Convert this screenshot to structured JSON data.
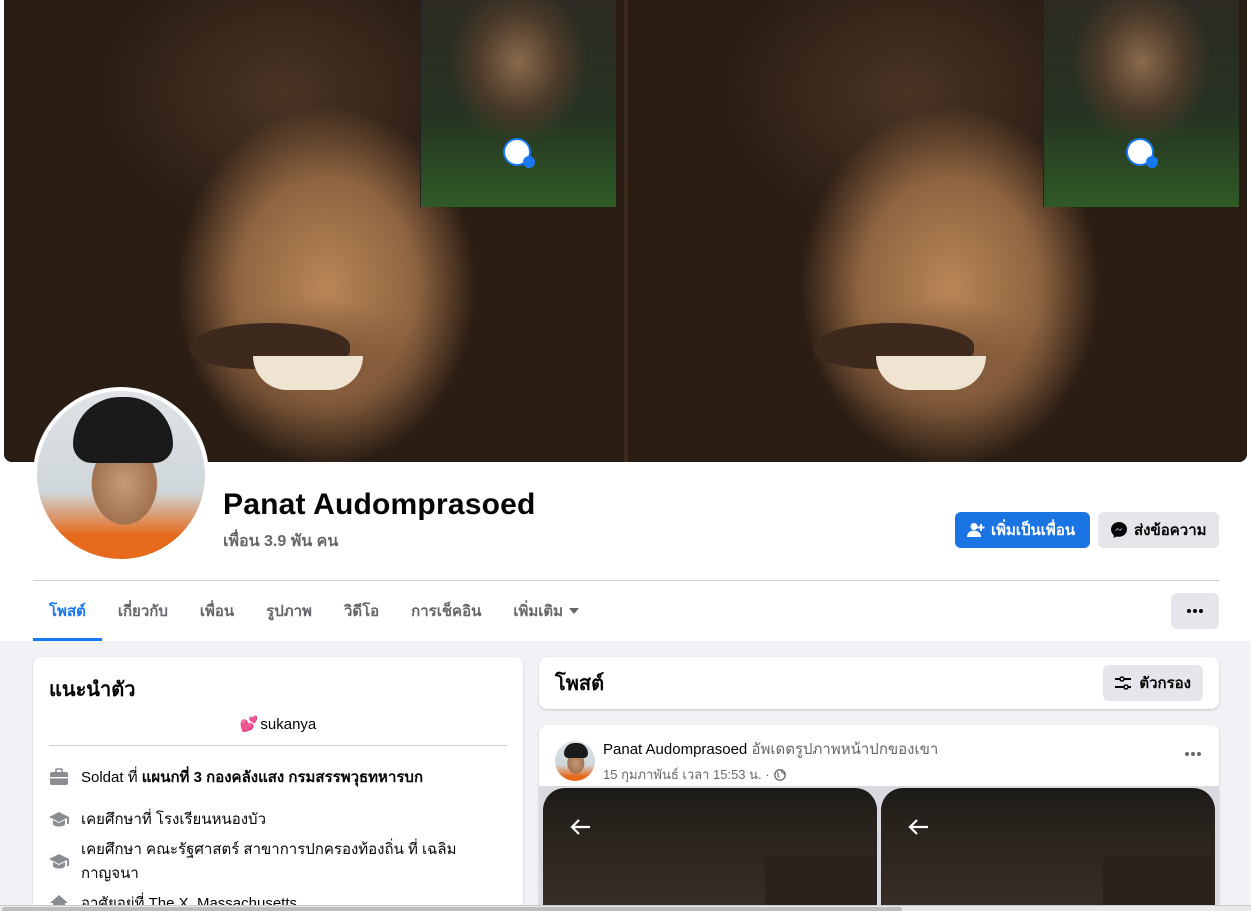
{
  "profile": {
    "name": "Panat Audomprasoed",
    "friends": "เพื่อน 3.9 พัน คน"
  },
  "actions": {
    "add_friend": "เพิ่มเป็นเพื่อน",
    "message": "ส่งข้อความ"
  },
  "tabs": [
    {
      "label": "โพสต์",
      "active": true
    },
    {
      "label": "เกี่ยวกับ",
      "active": false
    },
    {
      "label": "เพื่อน",
      "active": false
    },
    {
      "label": "รูปภาพ",
      "active": false
    },
    {
      "label": "วิดีโอ",
      "active": false
    },
    {
      "label": "การเช็คอิน",
      "active": false
    },
    {
      "label": "เพิ่มเติม",
      "active": false
    }
  ],
  "intro": {
    "title": "แนะนำตัว",
    "bio": "sukanya",
    "work": {
      "prefix": "Soldat ที่ ",
      "place": "แผนกที่ 3 กองคลังแสง กรมสรรพวุธทหารบก"
    },
    "edu1": "เคยศึกษาที่ โรงเรียนหนองบัว",
    "edu2": "เคยศึกษา คณะรัฐศาสตร์ สาขาการปกครองท้องถิ่น ที่ เฉลิมกาญจนา",
    "lives": "อาศัยอยู่ที่ The X, Massachusetts"
  },
  "posts": {
    "title": "โพสต์",
    "filter": "ตัวกรอง",
    "item": {
      "author": "Panat Audomprasoed",
      "action": "อัพเดตรูปภาพหน้าปกของเขา",
      "time": "15 กุมภาพันธ์ เวลา 15:53 น. ·"
    }
  },
  "colors": {
    "accent": "#1877f2",
    "button_primary": "#1b74e4",
    "secondary_bg": "#e4e6eb",
    "muted_text": "#65676b"
  }
}
